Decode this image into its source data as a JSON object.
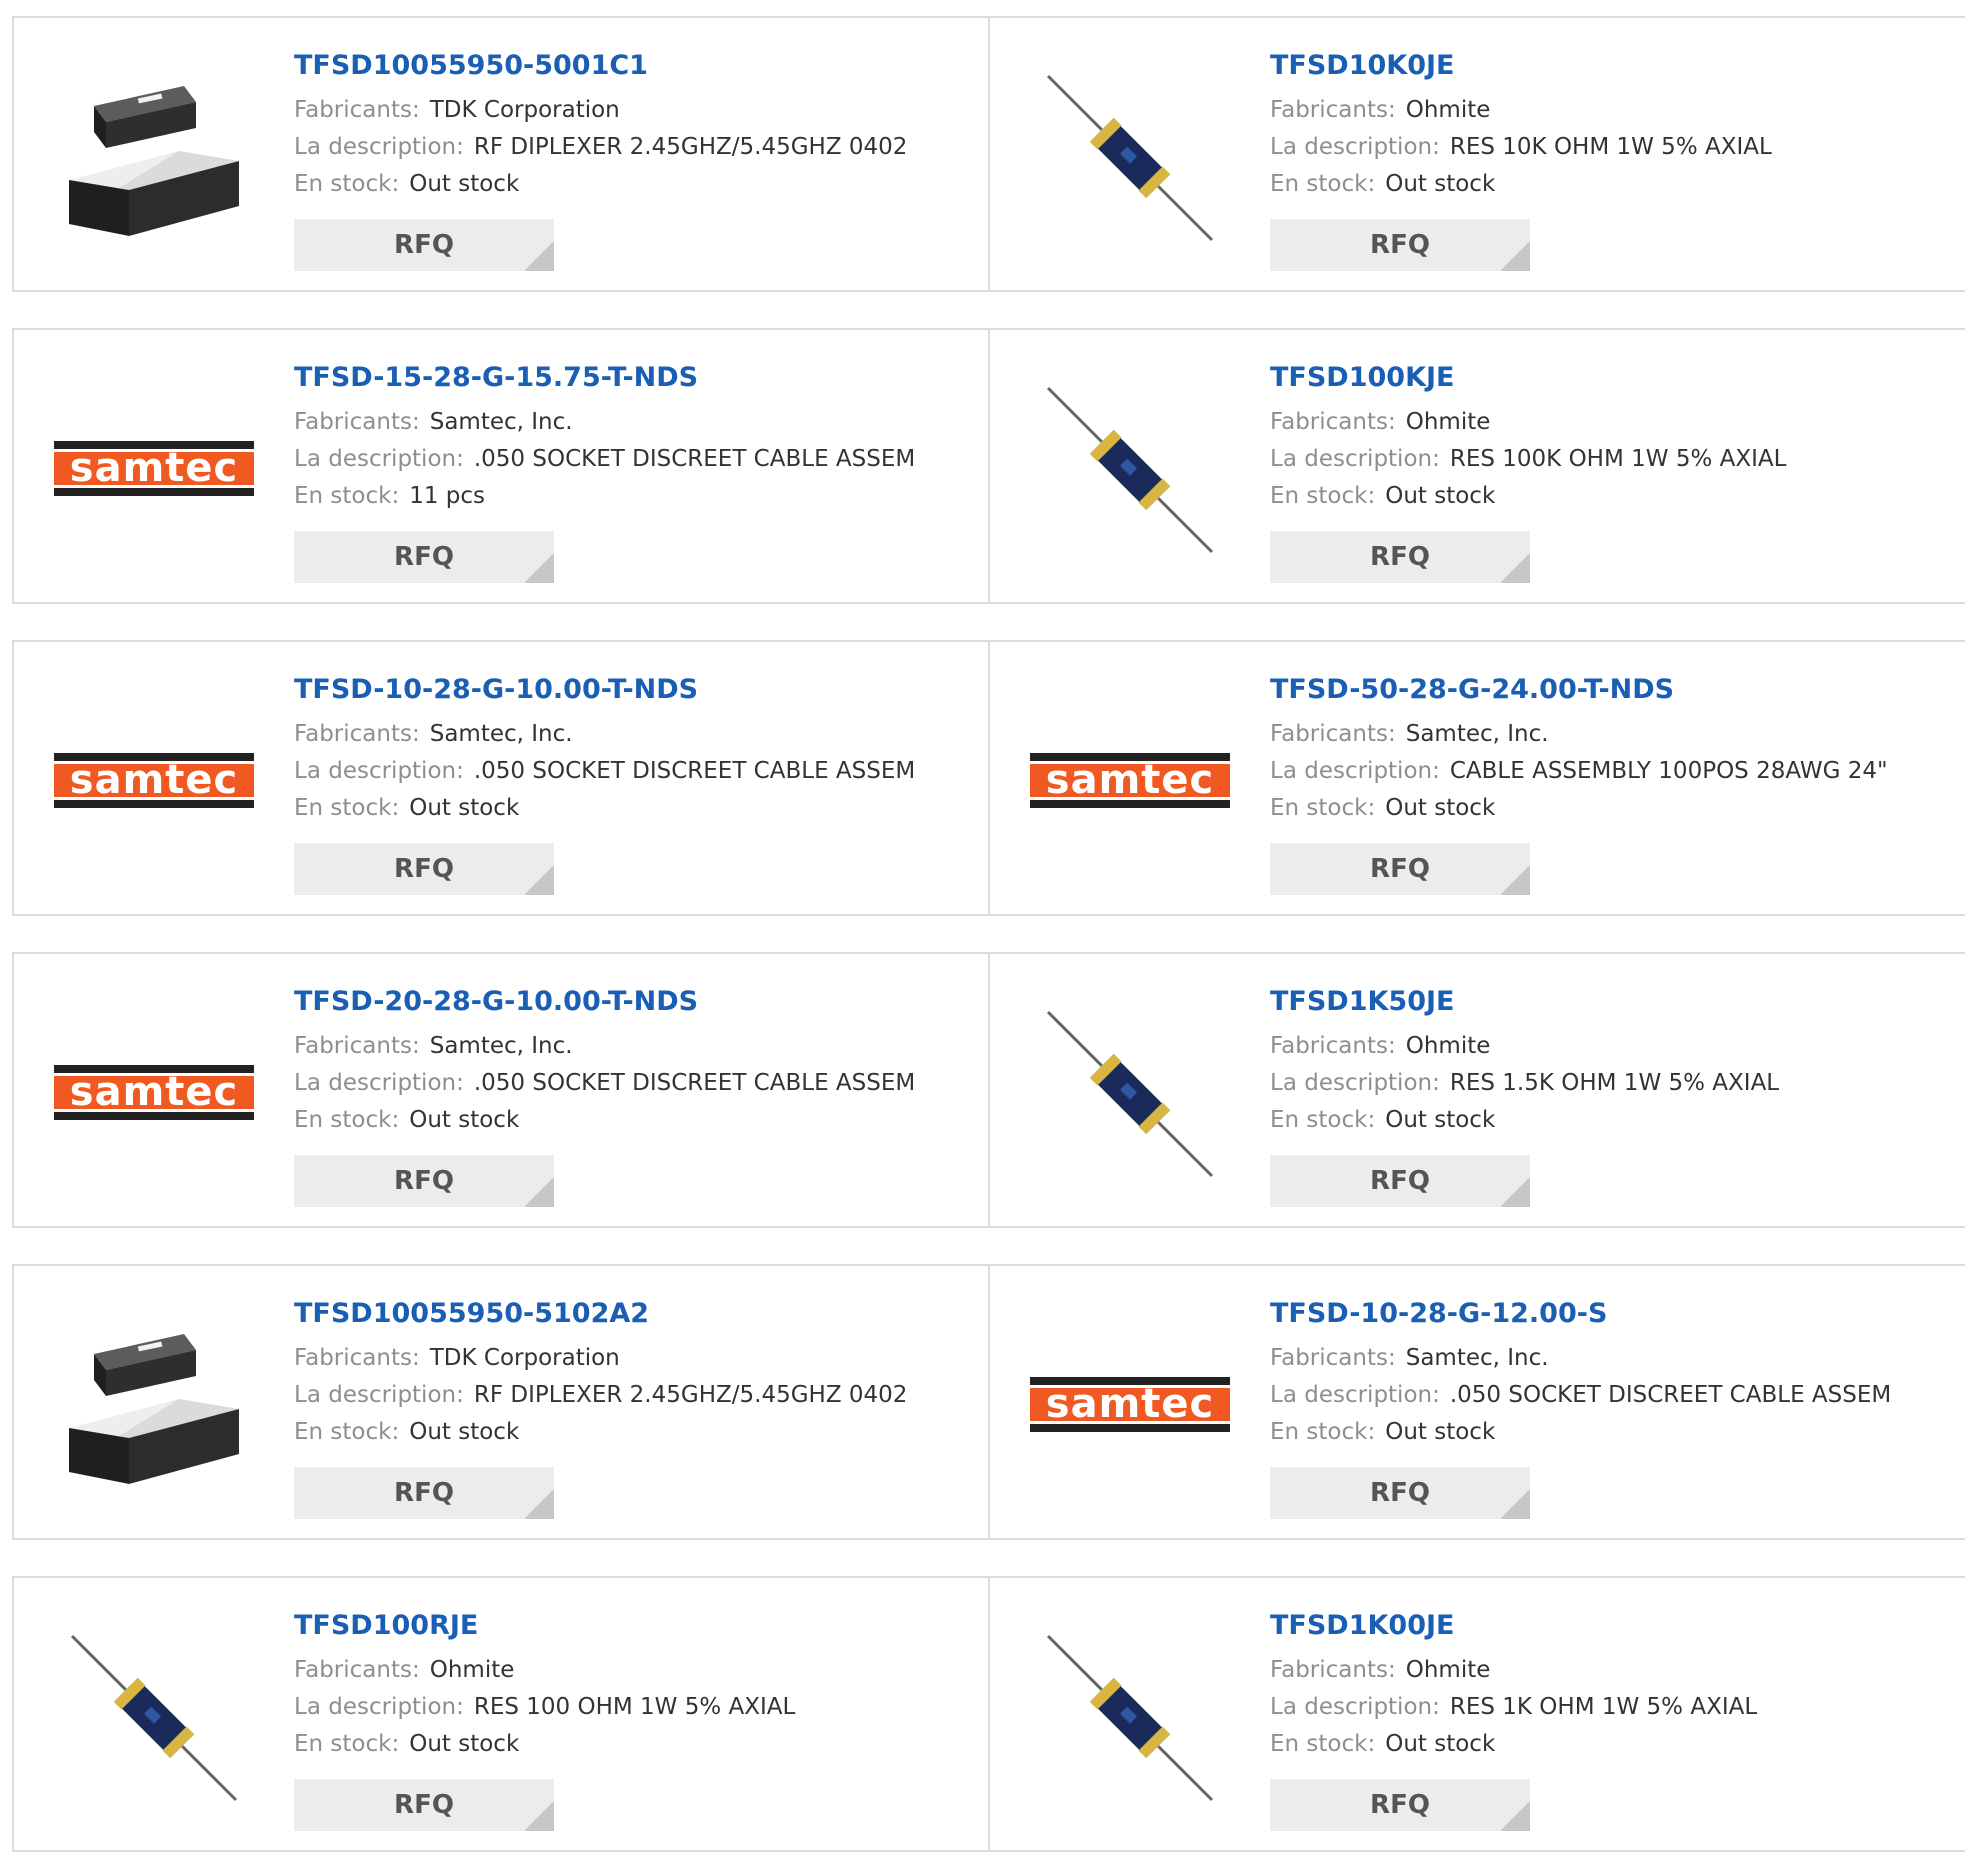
{
  "labels": {
    "manufacturer": "Fabricants:",
    "description": "La description:",
    "stock": "En stock:",
    "rfq": "RFQ"
  },
  "products": [
    {
      "part": "TFSD10055950-5001C1",
      "manufacturer": "TDK Corporation",
      "description": "RF DIPLEXER 2.45GHZ/5.45GHZ 0402",
      "stock": "Out stock",
      "image": "chip-component-icon"
    },
    {
      "part": "TFSD10K0JE",
      "manufacturer": "Ohmite",
      "description": "RES 10K OHM 1W 5% AXIAL",
      "stock": "Out stock",
      "image": "axial-resistor-icon"
    },
    {
      "part": "TFSD-15-28-G-15.75-T-NDS",
      "manufacturer": "Samtec, Inc.",
      "description": ".050 SOCKET DISCREET CABLE ASSEM",
      "stock": "11 pcs",
      "image": "samtec-logo"
    },
    {
      "part": "TFSD100KJE",
      "manufacturer": "Ohmite",
      "description": "RES 100K OHM 1W 5% AXIAL",
      "stock": "Out stock",
      "image": "axial-resistor-icon"
    },
    {
      "part": "TFSD-10-28-G-10.00-T-NDS",
      "manufacturer": "Samtec, Inc.",
      "description": ".050 SOCKET DISCREET CABLE ASSEM",
      "stock": "Out stock",
      "image": "samtec-logo"
    },
    {
      "part": "TFSD-50-28-G-24.00-T-NDS",
      "manufacturer": "Samtec, Inc.",
      "description": "CABLE ASSEMBLY 100POS 28AWG 24\"",
      "stock": "Out stock",
      "image": "samtec-logo"
    },
    {
      "part": "TFSD-20-28-G-10.00-T-NDS",
      "manufacturer": "Samtec, Inc.",
      "description": ".050 SOCKET DISCREET CABLE ASSEM",
      "stock": "Out stock",
      "image": "samtec-logo"
    },
    {
      "part": "TFSD1K50JE",
      "manufacturer": "Ohmite",
      "description": "RES 1.5K OHM 1W 5% AXIAL",
      "stock": "Out stock",
      "image": "axial-resistor-icon"
    },
    {
      "part": "TFSD10055950-5102A2",
      "manufacturer": "TDK Corporation",
      "description": "RF DIPLEXER 2.45GHZ/5.45GHZ 0402",
      "stock": "Out stock",
      "image": "chip-component-icon"
    },
    {
      "part": "TFSD-10-28-G-12.00-S",
      "manufacturer": "Samtec, Inc.",
      "description": ".050 SOCKET DISCREET CABLE ASSEM",
      "stock": "Out stock",
      "image": "samtec-logo"
    },
    {
      "part": "TFSD100RJE",
      "manufacturer": "Ohmite",
      "description": "RES 100 OHM 1W 5% AXIAL",
      "stock": "Out stock",
      "image": "axial-resistor-icon"
    },
    {
      "part": "TFSD1K00JE",
      "manufacturer": "Ohmite",
      "description": "RES 1K OHM 1W 5% AXIAL",
      "stock": "Out stock",
      "image": "axial-resistor-icon"
    }
  ],
  "colors": {
    "link": "#1a5fb4",
    "label": "#8e8e8e",
    "value": "#333333",
    "border": "#dcdcdc",
    "rfq_bg": "#ececec",
    "samtec_orange": "#f05a22"
  }
}
